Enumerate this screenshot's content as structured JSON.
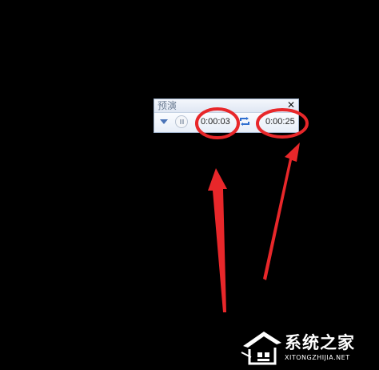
{
  "preview_window": {
    "title": "预演",
    "close_label": "✕",
    "current_time": "0:00:03",
    "total_time": "0:00:25"
  },
  "annotations": {
    "highlight_color": "#e8272a",
    "arrow_color": "#e8272a"
  },
  "watermark": {
    "name": "系统之家",
    "site": "XITONGZHIJIA.NET"
  }
}
